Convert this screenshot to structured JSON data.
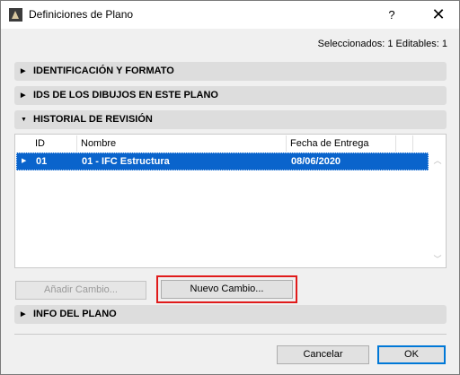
{
  "window": {
    "title": "Definiciones de Plano",
    "help": "?",
    "close": "✕"
  },
  "status": "Seleccionados: 1 Editables: 1",
  "sections": {
    "identificacion": "IDENTIFICACIÓN Y FORMATO",
    "ids_dibujos": "IDS DE LOS DIBUJOS EN ESTE PLANO",
    "historial": "HISTORIAL DE REVISIÓN",
    "info": "INFO DEL PLANO"
  },
  "table": {
    "columns": [
      "ID",
      "Nombre",
      "Fecha de Entrega"
    ],
    "rows": [
      {
        "id": "01",
        "nombre": "01 - IFC Estructura",
        "fecha": "08/06/2020",
        "selected": true
      }
    ]
  },
  "buttons": {
    "anadir": "Añadir Cambio...",
    "nuevo": "Nuevo Cambio...",
    "cancelar": "Cancelar",
    "ok": "OK"
  },
  "icons": {
    "collapsed": "triangle-right-icon",
    "expanded": "triangle-down-icon",
    "scroll_up": "chevron-up-icon",
    "scroll_down": "chevron-down-icon"
  },
  "colors": {
    "selection": "#0a64cc",
    "highlight": "#e01b1b",
    "section_bg": "#dddddd"
  }
}
